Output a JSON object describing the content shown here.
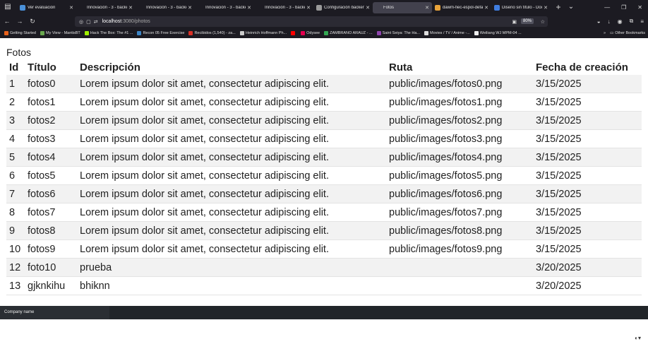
{
  "browser": {
    "tabs": [
      {
        "label": "Ver evaluación",
        "color": "#4a90d9",
        "active": false
      },
      {
        "label": "Innovación - 3 - backend :",
        "color": "#1c1b22",
        "active": false
      },
      {
        "label": "Innovación - 3 - backend :",
        "color": "#1c1b22",
        "active": false
      },
      {
        "label": "Innovación - 3 - backend :",
        "color": "#1c1b22",
        "active": false
      },
      {
        "label": "Innovación - 3 - backend :",
        "color": "#1c1b22",
        "active": false
      },
      {
        "label": "Configuración backend",
        "color": "#9a9a9a",
        "active": false
      },
      {
        "label": "Fotos",
        "color": "#42414d",
        "active": true
      },
      {
        "label": "dawm-fiec-espol-defa",
        "color": "#e8a33a",
        "active": false
      },
      {
        "label": "Diseño sin título - Doc",
        "color": "#3f7de0",
        "active": false
      }
    ],
    "new_tab_symbol": "+",
    "tab_list_symbol": "⌄",
    "url_host": "localhost",
    "url_path": ":3080/photos",
    "zoom": "80%",
    "bookmarks": [
      {
        "label": "Getting Started",
        "color": "#e8621c"
      },
      {
        "label": "My View - MantisBT",
        "color": "#6aa84f"
      },
      {
        "label": "Hack The Box: The #1 ...",
        "color": "#9fef00"
      },
      {
        "label": "Recon 05 Free Exercise",
        "color": "#3d85c6"
      },
      {
        "label": "Recibidos (1,540) - za...",
        "color": "#d93025"
      },
      {
        "label": "Heinrich Hoffmann Ph...",
        "color": "#cccccc"
      },
      {
        "label": "",
        "color": "#ff0000"
      },
      {
        "label": "Odysee",
        "color": "#e5004f"
      },
      {
        "label": "ZAMBRANO ARAUZ - ...",
        "color": "#34a853"
      },
      {
        "label": "Saint Seiya: The Ha...",
        "color": "#8e44ad"
      },
      {
        "label": "Movies / TV / Anime -...",
        "color": "#dddddd"
      },
      {
        "label": "Weiliang WJ MPM-04 ...",
        "color": "#eeeeee"
      }
    ],
    "other_bookmarks": "Other Bookmarks"
  },
  "page": {
    "title": "Fotos",
    "columns": [
      "Id",
      "Título",
      "Descripción",
      "Ruta",
      "Fecha de creación"
    ],
    "rows": [
      [
        "1",
        "fotos0",
        "Lorem ipsum dolor sit amet, consectetur adipiscing elit.",
        "public/images/fotos0.png",
        "3/15/2025"
      ],
      [
        "2",
        "fotos1",
        "Lorem ipsum dolor sit amet, consectetur adipiscing elit.",
        "public/images/fotos1.png",
        "3/15/2025"
      ],
      [
        "3",
        "fotos2",
        "Lorem ipsum dolor sit amet, consectetur adipiscing elit.",
        "public/images/fotos2.png",
        "3/15/2025"
      ],
      [
        "4",
        "fotos3",
        "Lorem ipsum dolor sit amet, consectetur adipiscing elit.",
        "public/images/fotos3.png",
        "3/15/2025"
      ],
      [
        "5",
        "fotos4",
        "Lorem ipsum dolor sit amet, consectetur adipiscing elit.",
        "public/images/fotos4.png",
        "3/15/2025"
      ],
      [
        "6",
        "fotos5",
        "Lorem ipsum dolor sit amet, consectetur adipiscing elit.",
        "public/images/fotos5.png",
        "3/15/2025"
      ],
      [
        "7",
        "fotos6",
        "Lorem ipsum dolor sit amet, consectetur adipiscing elit.",
        "public/images/fotos6.png",
        "3/15/2025"
      ],
      [
        "8",
        "fotos7",
        "Lorem ipsum dolor sit amet, consectetur adipiscing elit.",
        "public/images/fotos7.png",
        "3/15/2025"
      ],
      [
        "9",
        "fotos8",
        "Lorem ipsum dolor sit amet, consectetur adipiscing elit.",
        "public/images/fotos8.png",
        "3/15/2025"
      ],
      [
        "10",
        "fotos9",
        "Lorem ipsum dolor sit amet, consectetur adipiscing elit.",
        "public/images/fotos9.png",
        "3/15/2025"
      ],
      [
        "12",
        "foto10",
        "prueba",
        "",
        "3/20/2025"
      ],
      [
        "13",
        "gjknkihu",
        "bhiknn",
        "",
        "3/20/2025"
      ]
    ]
  },
  "footer": {
    "brand": "Company name"
  }
}
